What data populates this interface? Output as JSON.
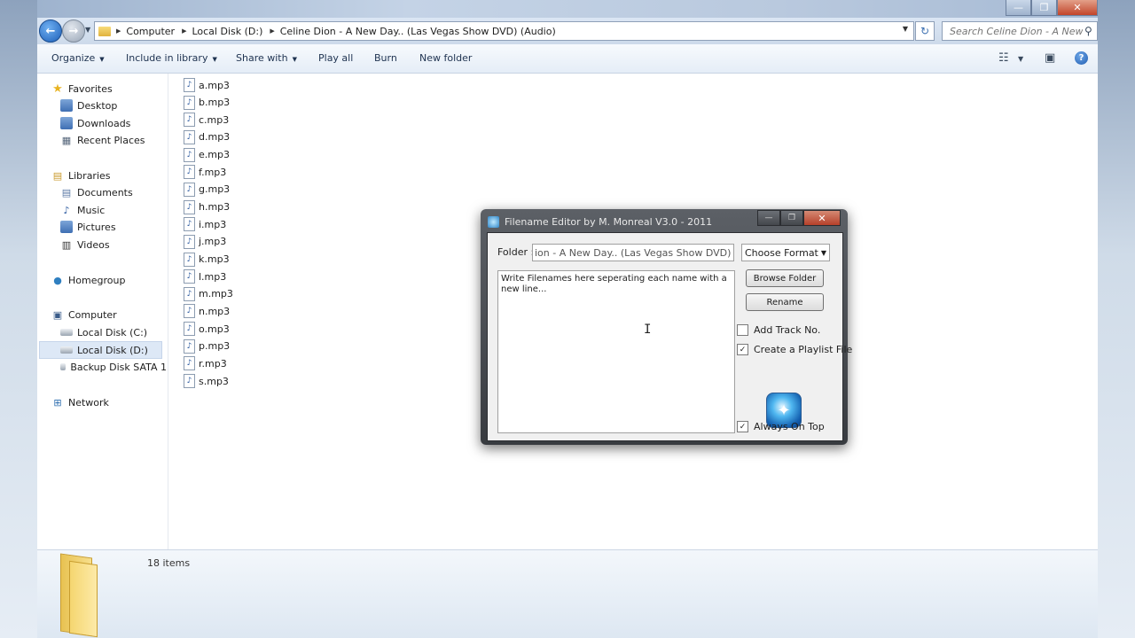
{
  "window": {
    "caption_buttons": [
      "—",
      "❐",
      "✕"
    ]
  },
  "address": {
    "crumbs": [
      "Computer",
      "Local Disk (D:)",
      "Celine Dion - A New Day.. (Las Vegas Show DVD) (Audio)"
    ],
    "search_placeholder": "Search Celine Dion - A New..."
  },
  "toolbar": {
    "organize": "Organize",
    "include_in_library": "Include in library",
    "share_with": "Share with",
    "play_all": "Play all",
    "burn": "Burn",
    "new_folder": "New folder",
    "help": "?"
  },
  "nav": {
    "favorites": "Favorites",
    "desktop": "Desktop",
    "downloads": "Downloads",
    "recent_places": "Recent Places",
    "libraries": "Libraries",
    "documents": "Documents",
    "music": "Music",
    "pictures": "Pictures",
    "videos": "Videos",
    "homegroup": "Homegroup",
    "computer": "Computer",
    "local_c": "Local Disk (C:)",
    "local_d": "Local Disk (D:)",
    "backup": "Backup Disk SATA 1",
    "network": "Network"
  },
  "files": [
    "a.mp3",
    "b.mp3",
    "c.mp3",
    "d.mp3",
    "e.mp3",
    "f.mp3",
    "g.mp3",
    "h.mp3",
    "i.mp3",
    "j.mp3",
    "k.mp3",
    "l.mp3",
    "m.mp3",
    "n.mp3",
    "o.mp3",
    "p.mp3",
    "r.mp3",
    "s.mp3"
  ],
  "status": {
    "items_count": "18 items"
  },
  "dialog": {
    "title": "Filename Editor by M. Monreal V3.0 - 2011",
    "folder_label": "Folder :",
    "folder_value": "ion - A New Day.. (Las Vegas Show DVD) (Audio)",
    "format_value": "Choose Format...",
    "textarea_text": "Write Filenames here seperating each name with a new line...",
    "browse_button": "Browse Folder",
    "rename_button": "Rename",
    "add_track_no": "Add Track No.",
    "create_playlist": "Create a Playlist File",
    "always_on_top": "Always On Top",
    "add_track_checked": false,
    "create_playlist_checked": true,
    "always_on_top_checked": true
  }
}
